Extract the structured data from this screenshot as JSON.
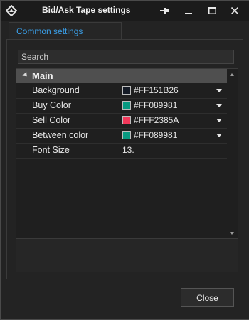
{
  "window": {
    "title": "Bid/Ask Tape settings",
    "icon": "app-logo-icon",
    "controls": {
      "pin": "pin-icon",
      "minimize": "minimize-icon",
      "maximize": "maximize-icon",
      "close": "close-icon"
    }
  },
  "tabs": [
    {
      "label": "Common settings",
      "active": true
    }
  ],
  "search": {
    "placeholder": "Search"
  },
  "property_grid": {
    "category": "Main",
    "properties": [
      {
        "name": "Background",
        "value": "#FF151B26",
        "swatch": "#151b26",
        "has_dropdown": true
      },
      {
        "name": "Buy Color",
        "value": "#FF089981",
        "swatch": "#089981",
        "has_dropdown": true
      },
      {
        "name": "Sell Color",
        "value": "#FFF2385A",
        "swatch": "#f2385a",
        "has_dropdown": true
      },
      {
        "name": "Between color",
        "value": "#FF089981",
        "swatch": "#089981",
        "has_dropdown": true
      },
      {
        "name": "Font Size",
        "value": "13.",
        "has_dropdown": false
      }
    ]
  },
  "footer": {
    "close_label": "Close"
  },
  "colors": {
    "accent": "#3a9fe8",
    "background": "#232323",
    "category_bg": "#4f4f4f"
  }
}
